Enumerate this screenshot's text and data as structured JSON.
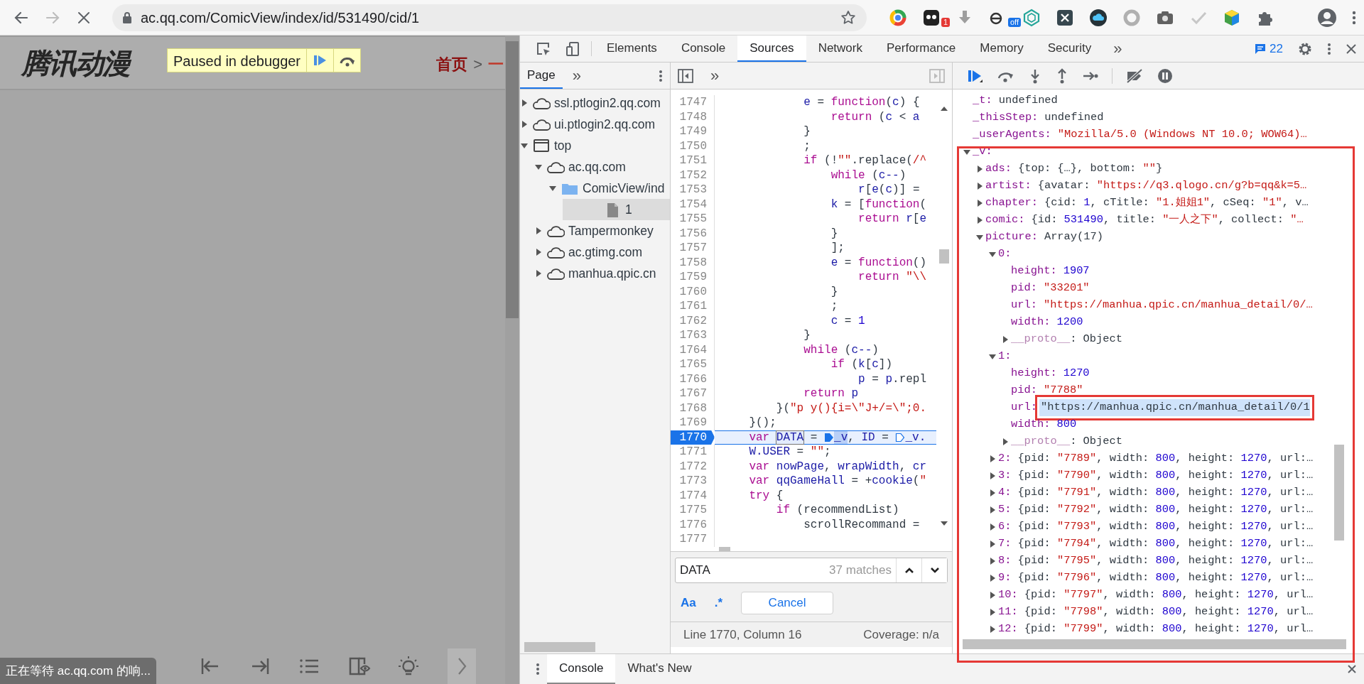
{
  "browser": {
    "back": {
      "disabled": false
    },
    "forward": {
      "disabled": true
    },
    "url": "ac.qq.com/ComicView/index/id/531490/cid/1",
    "extensions": [
      {
        "kind": "color-wheel"
      },
      {
        "kind": "dark-square",
        "badge": "1"
      },
      {
        "kind": "download"
      },
      {
        "kind": "letter-e",
        "badge": "off"
      },
      {
        "kind": "hexagon"
      },
      {
        "kind": "x-square"
      },
      {
        "kind": "cloud"
      },
      {
        "kind": "ring"
      },
      {
        "kind": "camera"
      },
      {
        "kind": "check"
      },
      {
        "kind": "globe"
      },
      {
        "kind": "puzzle"
      }
    ]
  },
  "page": {
    "logo": "腾讯动漫",
    "paused_label": "Paused in debugger",
    "breadcrumb": [
      {
        "kind": "link",
        "text": "首页"
      },
      {
        "kind": "sep",
        "text": ">"
      },
      {
        "kind": "current",
        "text": "一"
      }
    ],
    "status": "正在等待 ac.qq.com 的响...",
    "reader_tools": [
      {
        "kind": "first-page"
      },
      {
        "kind": "last-page"
      },
      {
        "kind": "list"
      },
      {
        "kind": "page-view"
      },
      {
        "kind": "bulb"
      },
      {
        "kind": "next"
      }
    ]
  },
  "devtools": {
    "tabs": [
      {
        "label": "Elements",
        "selected": false
      },
      {
        "label": "Console",
        "selected": false
      },
      {
        "label": "Sources",
        "selected": true
      },
      {
        "label": "Network",
        "selected": false
      },
      {
        "label": "Performance",
        "selected": false
      },
      {
        "label": "Memory",
        "selected": false
      },
      {
        "label": "Security",
        "selected": false
      }
    ],
    "more": "»",
    "messages": "22"
  },
  "navigator": {
    "tabs": [
      {
        "label": "Page",
        "selected": true
      }
    ],
    "more": "»",
    "tree": [
      {
        "label": "ssl.ptlogin2.qq.com",
        "kind": "cloud",
        "expanded": false,
        "selected": false
      },
      {
        "label": "ui.ptlogin2.qq.com",
        "kind": "cloud",
        "expanded": false,
        "selected": false
      },
      {
        "label": "top",
        "kind": "frame",
        "expanded": true,
        "selected": false,
        "children": [
          {
            "label": "ac.qq.com",
            "kind": "cloud",
            "expanded": true,
            "selected": false,
            "children": [
              {
                "label": "ComicView/ind",
                "kind": "folder",
                "expanded": true,
                "selected": false,
                "children": [
                  {
                    "label": "1",
                    "kind": "file",
                    "selected": true
                  }
                ]
              }
            ]
          },
          {
            "label": "Tampermonkey",
            "kind": "cloud",
            "expanded": false,
            "selected": false
          },
          {
            "label": "ac.gtimg.com",
            "kind": "cloud",
            "expanded": false,
            "selected": false
          },
          {
            "label": "manhua.qpic.cn",
            "kind": "cloud",
            "expanded": false,
            "selected": false
          }
        ]
      }
    ]
  },
  "editor": {
    "more": "»",
    "lines": [
      {
        "num": "1747",
        "current": false,
        "tokens": [
          {
            "kind": "name",
            "text": "            e"
          },
          {
            "kind": "plain",
            "text": " = "
          },
          {
            "kind": "keyword",
            "text": "function"
          },
          {
            "kind": "plain",
            "text": "("
          },
          {
            "kind": "name",
            "text": "c"
          },
          {
            "kind": "plain",
            "text": ") {"
          }
        ]
      },
      {
        "num": "1748",
        "current": false,
        "tokens": [
          {
            "kind": "keyword",
            "text": "                return"
          },
          {
            "kind": "plain",
            "text": " ("
          },
          {
            "kind": "name",
            "text": "c"
          },
          {
            "kind": "plain",
            "text": " < "
          },
          {
            "kind": "name",
            "text": "a"
          }
        ]
      },
      {
        "num": "1749",
        "current": false,
        "tokens": [
          {
            "kind": "plain",
            "text": "            }"
          }
        ]
      },
      {
        "num": "1750",
        "current": false,
        "tokens": [
          {
            "kind": "plain",
            "text": "            ;"
          }
        ]
      },
      {
        "num": "1751",
        "current": false,
        "tokens": [
          {
            "kind": "keyword",
            "text": "            if"
          },
          {
            "kind": "plain",
            "text": " (!"
          },
          {
            "kind": "string",
            "text": "\"\""
          },
          {
            "kind": "plain",
            "text": ".replace("
          },
          {
            "kind": "string",
            "text": "/^"
          }
        ]
      },
      {
        "num": "1752",
        "current": false,
        "tokens": [
          {
            "kind": "keyword",
            "text": "                while"
          },
          {
            "kind": "plain",
            "text": " ("
          },
          {
            "kind": "name",
            "text": "c--"
          },
          {
            "kind": "plain",
            "text": ")"
          }
        ]
      },
      {
        "num": "1753",
        "current": false,
        "tokens": [
          {
            "kind": "name",
            "text": "                    r"
          },
          {
            "kind": "plain",
            "text": "["
          },
          {
            "kind": "name",
            "text": "e"
          },
          {
            "kind": "plain",
            "text": "("
          },
          {
            "kind": "name",
            "text": "c"
          },
          {
            "kind": "plain",
            "text": ")] ="
          }
        ]
      },
      {
        "num": "1754",
        "current": false,
        "tokens": [
          {
            "kind": "name",
            "text": "                k"
          },
          {
            "kind": "plain",
            "text": " = ["
          },
          {
            "kind": "keyword",
            "text": "function"
          },
          {
            "kind": "plain",
            "text": "("
          }
        ]
      },
      {
        "num": "1755",
        "current": false,
        "tokens": [
          {
            "kind": "keyword",
            "text": "                    return"
          },
          {
            "kind": "name",
            "text": " r"
          },
          {
            "kind": "plain",
            "text": "["
          },
          {
            "kind": "name",
            "text": "e"
          }
        ]
      },
      {
        "num": "1756",
        "current": false,
        "tokens": [
          {
            "kind": "plain",
            "text": "                }"
          }
        ]
      },
      {
        "num": "1757",
        "current": false,
        "tokens": [
          {
            "kind": "plain",
            "text": "                ];"
          }
        ]
      },
      {
        "num": "1758",
        "current": false,
        "tokens": [
          {
            "kind": "name",
            "text": "                e"
          },
          {
            "kind": "plain",
            "text": " = "
          },
          {
            "kind": "keyword",
            "text": "function"
          },
          {
            "kind": "plain",
            "text": "()"
          }
        ]
      },
      {
        "num": "1759",
        "current": false,
        "tokens": [
          {
            "kind": "keyword",
            "text": "                    return"
          },
          {
            "kind": "string",
            "text": " \"\\\\"
          }
        ]
      },
      {
        "num": "1760",
        "current": false,
        "tokens": [
          {
            "kind": "plain",
            "text": "                }"
          }
        ]
      },
      {
        "num": "1761",
        "current": false,
        "tokens": [
          {
            "kind": "plain",
            "text": "                ;"
          }
        ]
      },
      {
        "num": "1762",
        "current": false,
        "tokens": [
          {
            "kind": "name",
            "text": "                c"
          },
          {
            "kind": "plain",
            "text": " = "
          },
          {
            "kind": "number",
            "text": "1"
          }
        ]
      },
      {
        "num": "1763",
        "current": false,
        "tokens": [
          {
            "kind": "plain",
            "text": "            }"
          }
        ]
      },
      {
        "num": "1764",
        "current": false,
        "tokens": [
          {
            "kind": "keyword",
            "text": "            while"
          },
          {
            "kind": "plain",
            "text": " ("
          },
          {
            "kind": "name",
            "text": "c--"
          },
          {
            "kind": "plain",
            "text": ")"
          }
        ]
      },
      {
        "num": "1765",
        "current": false,
        "tokens": [
          {
            "kind": "keyword",
            "text": "                if"
          },
          {
            "kind": "plain",
            "text": " ("
          },
          {
            "kind": "name",
            "text": "k"
          },
          {
            "kind": "plain",
            "text": "["
          },
          {
            "kind": "name",
            "text": "c"
          },
          {
            "kind": "plain",
            "text": "])"
          }
        ]
      },
      {
        "num": "1766",
        "current": false,
        "tokens": [
          {
            "kind": "name",
            "text": "                    p"
          },
          {
            "kind": "plain",
            "text": " = "
          },
          {
            "kind": "name",
            "text": "p"
          },
          {
            "kind": "plain",
            "text": ".repl"
          }
        ]
      },
      {
        "num": "1767",
        "current": false,
        "tokens": [
          {
            "kind": "keyword",
            "text": "            return"
          },
          {
            "kind": "name",
            "text": " p"
          }
        ]
      },
      {
        "num": "1768",
        "current": false,
        "tokens": [
          {
            "kind": "plain",
            "text": "        }("
          },
          {
            "kind": "string",
            "text": "\"p y(){i=\\\"J+/=\\\";0."
          }
        ]
      },
      {
        "num": "1769",
        "current": false,
        "tokens": [
          {
            "kind": "plain",
            "text": "    }();"
          }
        ]
      },
      {
        "num": "1770",
        "current": true,
        "tokens": [
          {
            "kind": "keyword",
            "text": "    var "
          },
          {
            "kind": "match",
            "text": "DATA"
          },
          {
            "kind": "plain",
            "text": " = "
          },
          {
            "kind": "marker",
            "active": true
          },
          {
            "kind": "highlight",
            "text": "_v"
          },
          {
            "kind": "plain",
            "text": ", "
          },
          {
            "kind": "name",
            "text": "ID"
          },
          {
            "kind": "plain",
            "text": " = "
          },
          {
            "kind": "marker",
            "active": false
          },
          {
            "kind": "name",
            "text": "_v."
          }
        ]
      },
      {
        "num": "1771",
        "current": false,
        "tokens": [
          {
            "kind": "name",
            "text": "    W.USER"
          },
          {
            "kind": "plain",
            "text": " = "
          },
          {
            "kind": "string",
            "text": "\"\""
          },
          {
            "kind": "plain",
            "text": ";"
          }
        ]
      },
      {
        "num": "1772",
        "current": false,
        "tokens": [
          {
            "kind": "keyword",
            "text": "    var "
          },
          {
            "kind": "name",
            "text": "nowPage"
          },
          {
            "kind": "plain",
            "text": ", "
          },
          {
            "kind": "name",
            "text": "wrapWidth"
          },
          {
            "kind": "plain",
            "text": ", "
          },
          {
            "kind": "name",
            "text": "cr"
          }
        ]
      },
      {
        "num": "1773",
        "current": false,
        "tokens": [
          {
            "kind": "keyword",
            "text": "    var "
          },
          {
            "kind": "name",
            "text": "qqGameHall"
          },
          {
            "kind": "plain",
            "text": " = +"
          },
          {
            "kind": "name",
            "text": "cookie"
          },
          {
            "kind": "plain",
            "text": "("
          },
          {
            "kind": "string",
            "text": "\""
          }
        ]
      },
      {
        "num": "1774",
        "current": false,
        "tokens": [
          {
            "kind": "keyword",
            "text": "    try"
          },
          {
            "kind": "plain",
            "text": " {"
          }
        ]
      },
      {
        "num": "1775",
        "current": false,
        "tokens": [
          {
            "kind": "keyword",
            "text": "        if"
          },
          {
            "kind": "plain",
            "text": " (recommendList)"
          }
        ]
      },
      {
        "num": "1776",
        "current": false,
        "tokens": [
          {
            "kind": "plain",
            "text": "            scrollRecommand ="
          }
        ]
      },
      {
        "num": "1777",
        "current": false
      }
    ]
  },
  "search": {
    "query": "DATA",
    "matches": "37 matches",
    "case_toggle": "Aa",
    "regex_toggle": ".*",
    "cancel": "Cancel"
  },
  "status": {
    "position": "Line 1770, Column 16",
    "coverage": "Coverage: n/a"
  },
  "scope": {
    "rows": [
      {
        "key": "_t:",
        "value": [
          {
            "kind": "plain",
            "text": "undefined"
          }
        ]
      },
      {
        "key": "_thisStep:",
        "value": [
          {
            "kind": "plain",
            "text": "undefined"
          }
        ]
      },
      {
        "key": "_userAgents:",
        "value": [
          {
            "kind": "string",
            "text": "\"Mozilla/5.0 (Windows NT 10.0; WOW64)…"
          }
        ]
      },
      {
        "key": "_v:",
        "expanded": true,
        "children": [
          {
            "key": "ads:",
            "expanded": false,
            "value": [
              {
                "kind": "plain",
                "text": "{top: {…}, bottom: "
              },
              {
                "kind": "string",
                "text": "\"\""
              },
              {
                "kind": "plain",
                "text": "}"
              }
            ]
          },
          {
            "key": "artist:",
            "expanded": false,
            "value": [
              {
                "kind": "plain",
                "text": "{avatar: "
              },
              {
                "kind": "string",
                "text": "\"https://q3.qlogo.cn/g?b=qq&k=5…"
              }
            ]
          },
          {
            "key": "chapter:",
            "expanded": false,
            "value": [
              {
                "kind": "plain",
                "text": "{cid: "
              },
              {
                "kind": "number",
                "text": "1"
              },
              {
                "kind": "plain",
                "text": ", cTitle: "
              },
              {
                "kind": "string",
                "text": "\"1.姐姐1\""
              },
              {
                "kind": "plain",
                "text": ", cSeq: "
              },
              {
                "kind": "string",
                "text": "\"1\""
              },
              {
                "kind": "plain",
                "text": ", v…"
              }
            ]
          },
          {
            "key": "comic:",
            "expanded": false,
            "value": [
              {
                "kind": "plain",
                "text": "{id: "
              },
              {
                "kind": "number",
                "text": "531490"
              },
              {
                "kind": "plain",
                "text": ", title: "
              },
              {
                "kind": "string",
                "text": "\"一人之下\""
              },
              {
                "kind": "plain",
                "text": ", collect: "
              },
              {
                "kind": "string",
                "text": "\"…"
              }
            ]
          },
          {
            "key": "picture:",
            "expanded": true,
            "value": [
              {
                "kind": "plain",
                "text": "Array(17)"
              }
            ],
            "children": [
              {
                "key": "0:",
                "expanded": true,
                "children": [
                  {
                    "key": "height:",
                    "value": [
                      {
                        "kind": "number",
                        "text": "1907"
                      }
                    ]
                  },
                  {
                    "key": "pid:",
                    "value": [
                      {
                        "kind": "string",
                        "text": "\"33201\""
                      }
                    ]
                  },
                  {
                    "key": "url:",
                    "value": [
                      {
                        "kind": "string",
                        "text": "\"https://manhua.qpic.cn/manhua_detail/0/…"
                      }
                    ]
                  },
                  {
                    "key": "width:",
                    "value": [
                      {
                        "kind": "number",
                        "text": "1200"
                      }
                    ]
                  },
                  {
                    "key": "__proto__",
                    "kind": "internal",
                    "expanded": false,
                    "value": [
                      {
                        "kind": "plain",
                        "text": ": Object"
                      }
                    ]
                  }
                ]
              },
              {
                "key": "1:",
                "expanded": true,
                "children": [
                  {
                    "key": "height:",
                    "selected": false,
                    "value": [
                      {
                        "kind": "number",
                        "text": "1270"
                      }
                    ]
                  },
                  {
                    "key": "pid:",
                    "selected": false,
                    "value": [
                      {
                        "kind": "string",
                        "text": "\"7788\""
                      }
                    ]
                  },
                  {
                    "key": "url:",
                    "selected": true,
                    "value": [
                      {
                        "kind": "plain",
                        "text": "\"https://manhua.qpic.cn/manhua_detail/0/1"
                      }
                    ]
                  },
                  {
                    "key": "width:",
                    "selected": false,
                    "value": [
                      {
                        "kind": "number",
                        "text": "800"
                      }
                    ]
                  },
                  {
                    "key": "__proto__",
                    "kind": "internal",
                    "selected": false,
                    "expanded": false,
                    "value": [
                      {
                        "kind": "plain",
                        "text": ": Object"
                      }
                    ]
                  }
                ]
              },
              {
                "key": "2:",
                "expanded": false,
                "value": [
                  {
                    "kind": "plain",
                    "text": "{pid: "
                  },
                  {
                    "kind": "string",
                    "text": "\"7789\""
                  },
                  {
                    "kind": "plain",
                    "text": ", width: "
                  },
                  {
                    "kind": "number",
                    "text": "800"
                  },
                  {
                    "kind": "plain",
                    "text": ", height: "
                  },
                  {
                    "kind": "number",
                    "text": "1270"
                  },
                  {
                    "kind": "plain",
                    "text": ", url:…"
                  }
                ]
              },
              {
                "key": "3:",
                "expanded": false,
                "value": [
                  {
                    "kind": "plain",
                    "text": "{pid: "
                  },
                  {
                    "kind": "string",
                    "text": "\"7790\""
                  },
                  {
                    "kind": "plain",
                    "text": ", width: "
                  },
                  {
                    "kind": "number",
                    "text": "800"
                  },
                  {
                    "kind": "plain",
                    "text": ", height: "
                  },
                  {
                    "kind": "number",
                    "text": "1270"
                  },
                  {
                    "kind": "plain",
                    "text": ", url:…"
                  }
                ]
              },
              {
                "key": "4:",
                "expanded": false,
                "value": [
                  {
                    "kind": "plain",
                    "text": "{pid: "
                  },
                  {
                    "kind": "string",
                    "text": "\"7791\""
                  },
                  {
                    "kind": "plain",
                    "text": ", width: "
                  },
                  {
                    "kind": "number",
                    "text": "800"
                  },
                  {
                    "kind": "plain",
                    "text": ", height: "
                  },
                  {
                    "kind": "number",
                    "text": "1270"
                  },
                  {
                    "kind": "plain",
                    "text": ", url:…"
                  }
                ]
              },
              {
                "key": "5:",
                "expanded": false,
                "value": [
                  {
                    "kind": "plain",
                    "text": "{pid: "
                  },
                  {
                    "kind": "string",
                    "text": "\"7792\""
                  },
                  {
                    "kind": "plain",
                    "text": ", width: "
                  },
                  {
                    "kind": "number",
                    "text": "800"
                  },
                  {
                    "kind": "plain",
                    "text": ", height: "
                  },
                  {
                    "kind": "number",
                    "text": "1270"
                  },
                  {
                    "kind": "plain",
                    "text": ", url:…"
                  }
                ]
              },
              {
                "key": "6:",
                "expanded": false,
                "value": [
                  {
                    "kind": "plain",
                    "text": "{pid: "
                  },
                  {
                    "kind": "string",
                    "text": "\"7793\""
                  },
                  {
                    "kind": "plain",
                    "text": ", width: "
                  },
                  {
                    "kind": "number",
                    "text": "800"
                  },
                  {
                    "kind": "plain",
                    "text": ", height: "
                  },
                  {
                    "kind": "number",
                    "text": "1270"
                  },
                  {
                    "kind": "plain",
                    "text": ", url:…"
                  }
                ]
              },
              {
                "key": "7:",
                "expanded": false,
                "value": [
                  {
                    "kind": "plain",
                    "text": "{pid: "
                  },
                  {
                    "kind": "string",
                    "text": "\"7794\""
                  },
                  {
                    "kind": "plain",
                    "text": ", width: "
                  },
                  {
                    "kind": "number",
                    "text": "800"
                  },
                  {
                    "kind": "plain",
                    "text": ", height: "
                  },
                  {
                    "kind": "number",
                    "text": "1270"
                  },
                  {
                    "kind": "plain",
                    "text": ", url:…"
                  }
                ]
              },
              {
                "key": "8:",
                "expanded": false,
                "value": [
                  {
                    "kind": "plain",
                    "text": "{pid: "
                  },
                  {
                    "kind": "string",
                    "text": "\"7795\""
                  },
                  {
                    "kind": "plain",
                    "text": ", width: "
                  },
                  {
                    "kind": "number",
                    "text": "800"
                  },
                  {
                    "kind": "plain",
                    "text": ", height: "
                  },
                  {
                    "kind": "number",
                    "text": "1270"
                  },
                  {
                    "kind": "plain",
                    "text": ", url:…"
                  }
                ]
              },
              {
                "key": "9:",
                "expanded": false,
                "value": [
                  {
                    "kind": "plain",
                    "text": "{pid: "
                  },
                  {
                    "kind": "string",
                    "text": "\"7796\""
                  },
                  {
                    "kind": "plain",
                    "text": ", width: "
                  },
                  {
                    "kind": "number",
                    "text": "800"
                  },
                  {
                    "kind": "plain",
                    "text": ", height: "
                  },
                  {
                    "kind": "number",
                    "text": "1270"
                  },
                  {
                    "kind": "plain",
                    "text": ", url:…"
                  }
                ]
              },
              {
                "key": "10:",
                "expanded": false,
                "value": [
                  {
                    "kind": "plain",
                    "text": "{pid: "
                  },
                  {
                    "kind": "string",
                    "text": "\"7797\""
                  },
                  {
                    "kind": "plain",
                    "text": ", width: "
                  },
                  {
                    "kind": "number",
                    "text": "800"
                  },
                  {
                    "kind": "plain",
                    "text": ", height: "
                  },
                  {
                    "kind": "number",
                    "text": "1270"
                  },
                  {
                    "kind": "plain",
                    "text": ", url…"
                  }
                ]
              },
              {
                "key": "11:",
                "expanded": false,
                "value": [
                  {
                    "kind": "plain",
                    "text": "{pid: "
                  },
                  {
                    "kind": "string",
                    "text": "\"7798\""
                  },
                  {
                    "kind": "plain",
                    "text": ", width: "
                  },
                  {
                    "kind": "number",
                    "text": "800"
                  },
                  {
                    "kind": "plain",
                    "text": ", height: "
                  },
                  {
                    "kind": "number",
                    "text": "1270"
                  },
                  {
                    "kind": "plain",
                    "text": ", url…"
                  }
                ]
              },
              {
                "key": "12:",
                "expanded": false,
                "value": [
                  {
                    "kind": "plain",
                    "text": "{pid: "
                  },
                  {
                    "kind": "string",
                    "text": "\"7799\""
                  },
                  {
                    "kind": "plain",
                    "text": ", width: "
                  },
                  {
                    "kind": "number",
                    "text": "800"
                  },
                  {
                    "kind": "plain",
                    "text": ", height: "
                  },
                  {
                    "kind": "number",
                    "text": "1270"
                  },
                  {
                    "kind": "plain",
                    "text": ", url…"
                  }
                ]
              }
            ]
          }
        ]
      }
    ]
  },
  "drawer": {
    "tabs": [
      {
        "label": "Console",
        "selected": true
      },
      {
        "label": "What's New",
        "selected": false
      }
    ]
  }
}
